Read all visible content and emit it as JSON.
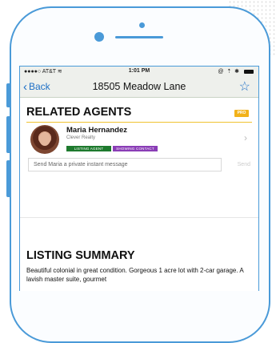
{
  "status_bar": {
    "carrier": "AT&T",
    "time": "1:01 PM",
    "icons": "@ ⇡ ✱"
  },
  "nav": {
    "back_label": "Back",
    "title": "18505 Meadow Lane"
  },
  "related_agents": {
    "title": "RELATED AGENTS",
    "pro_badge": "PRO",
    "agent": {
      "name": "Maria Hernandez",
      "company": "Clever Realty",
      "tags": [
        "LISTING AGENT",
        "SHOWING CONTACT"
      ]
    },
    "message_placeholder": "Send Maria a private instant message",
    "send_label": "Send"
  },
  "listing_summary": {
    "title": "LISTING SUMMARY",
    "text": "Beautiful colonial in great condition. Gorgeous 1 acre lot with 2-car garage. A lavish master suite, gourmet"
  },
  "colors": {
    "phone_frame": "#4a9ad8",
    "nav_bg": "#eef0ec",
    "link": "#1d6fc6",
    "pro_badge": "#f2b21a",
    "listing_tag": "#1e7a2e",
    "showing_tag": "#8a3db6",
    "divider": "#f0c230"
  }
}
